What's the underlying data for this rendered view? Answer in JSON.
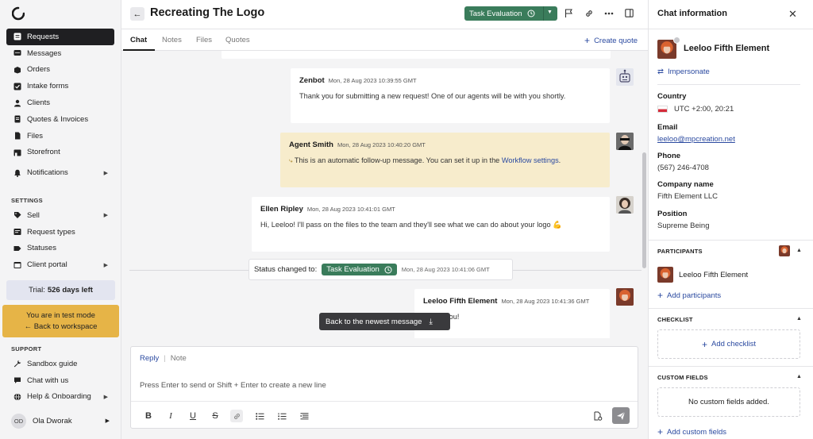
{
  "sidebar": {
    "nav": [
      {
        "label": "Requests",
        "icon": "requests-icon",
        "active": true
      },
      {
        "label": "Messages",
        "icon": "messages-icon"
      },
      {
        "label": "Orders",
        "icon": "orders-icon"
      },
      {
        "label": "Intake forms",
        "icon": "intake-forms-icon"
      },
      {
        "label": "Clients",
        "icon": "clients-icon"
      },
      {
        "label": "Quotes & Invoices",
        "icon": "quotes-invoices-icon"
      },
      {
        "label": "Files",
        "icon": "files-icon"
      },
      {
        "label": "Storefront",
        "icon": "storefront-icon"
      },
      {
        "label": "Notifications",
        "icon": "bell-icon",
        "arrow": true
      }
    ],
    "settings_title": "SETTINGS",
    "settings": [
      {
        "label": "Sell",
        "icon": "sell-icon",
        "arrow": true
      },
      {
        "label": "Request types",
        "icon": "request-types-icon"
      },
      {
        "label": "Statuses",
        "icon": "statuses-icon"
      },
      {
        "label": "Client portal",
        "icon": "client-portal-icon",
        "arrow": true
      }
    ],
    "trial_label": "Trial:",
    "trial_value": "526 days left",
    "test_mode_text": "You are in test mode",
    "back_to_workspace": "Back to workspace",
    "support_title": "SUPPORT",
    "support": [
      {
        "label": "Sandbox guide",
        "icon": "wrench-icon"
      },
      {
        "label": "Chat with us",
        "icon": "chat-icon"
      },
      {
        "label": "Help & Onboarding",
        "icon": "globe-icon",
        "arrow": true
      }
    ],
    "user_initials": "OD",
    "user_name": "Ola Dworak"
  },
  "header": {
    "title": "Recreating The Logo",
    "status": "Task Evaluation"
  },
  "tabs": [
    "Chat",
    "Notes",
    "Files",
    "Quotes"
  ],
  "create_quote": "Create quote",
  "messages": [
    {
      "author": "Zenbot",
      "time": "Mon, 28 Aug 2023 10:39:55 GMT",
      "text": "Thank you for submitting a new request! One of our agents will be with you shortly."
    },
    {
      "author": "Agent Smith",
      "time": "Mon, 28 Aug 2023 10:40:20 GMT",
      "text_before": "This is an automatic follow-up message. You can set it up in the ",
      "link": "Workflow settings",
      "text_after": "."
    },
    {
      "author": "Ellen Ripley",
      "time": "Mon, 28 Aug 2023 10:41:01 GMT",
      "text": "Hi, Leeloo! I'll pass on the files to the team and they'll see what we can do about your logo 💪"
    },
    {
      "author": "Leeloo Fifth Element",
      "time": "Mon, 28 Aug 2023 10:41:36 GMT",
      "text": "Thank you!"
    }
  ],
  "status_change": {
    "label": "Status changed to:",
    "status": "Task Evaluation",
    "time": "Mon, 28 Aug 2023 10:41:06 GMT"
  },
  "back_newest": "Back to the newest message",
  "composer": {
    "reply": "Reply",
    "note": "Note",
    "placeholder": "Press Enter to send or Shift + Enter to create a new line"
  },
  "panel": {
    "title": "Chat information",
    "contact_name": "Leeloo Fifth Element",
    "impersonate": "Impersonate",
    "country_label": "Country",
    "country_value": "UTC +2:00, 20:21",
    "email_label": "Email",
    "email_value": "leeloo@mpcreation.net",
    "phone_label": "Phone",
    "phone_value": "(567) 246-4708",
    "company_label": "Company name",
    "company_value": "Fifth Element LLC",
    "position_label": "Position",
    "position_value": "Supreme Being",
    "participants_title": "PARTICIPANTS",
    "participant_name": "Leeloo Fifth Element",
    "add_participants": "Add participants",
    "checklist_title": "CHECKLIST",
    "add_checklist": "Add checklist",
    "custom_fields_title": "CUSTOM FIELDS",
    "no_custom_fields": "No custom fields added.",
    "add_custom_fields": "Add custom fields"
  },
  "colors": {
    "accent": "#2b4aa0",
    "status_green": "#3a7c5b",
    "test_mode": "#e6b447",
    "agent_bg": "#f7eccc"
  }
}
